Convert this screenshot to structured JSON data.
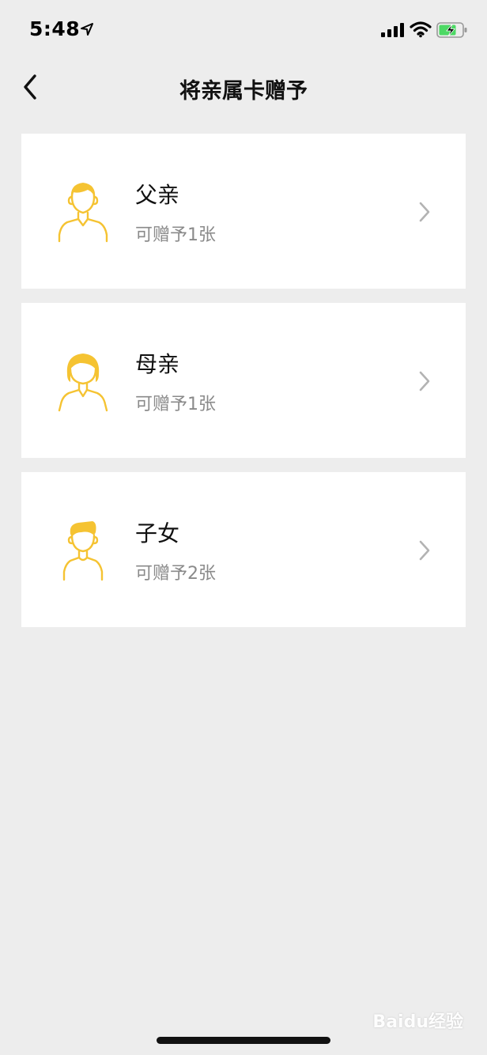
{
  "status_bar": {
    "time": "5:48",
    "icons": [
      "location-arrow-icon",
      "cellular-signal-icon",
      "wifi-icon",
      "battery-charging-icon"
    ],
    "battery_color": "#4cd964"
  },
  "nav": {
    "back_icon": "chevron-left-icon",
    "title": "将亲属卡赠予"
  },
  "accent_color": "#f5c332",
  "members": [
    {
      "name": "父亲",
      "quota": "可赠予1张",
      "avatar": "father-avatar-icon"
    },
    {
      "name": "母亲",
      "quota": "可赠予1张",
      "avatar": "mother-avatar-icon"
    },
    {
      "name": "子女",
      "quota": "可赠予2张",
      "avatar": "child-avatar-icon"
    }
  ],
  "watermark": "Baidu经验"
}
